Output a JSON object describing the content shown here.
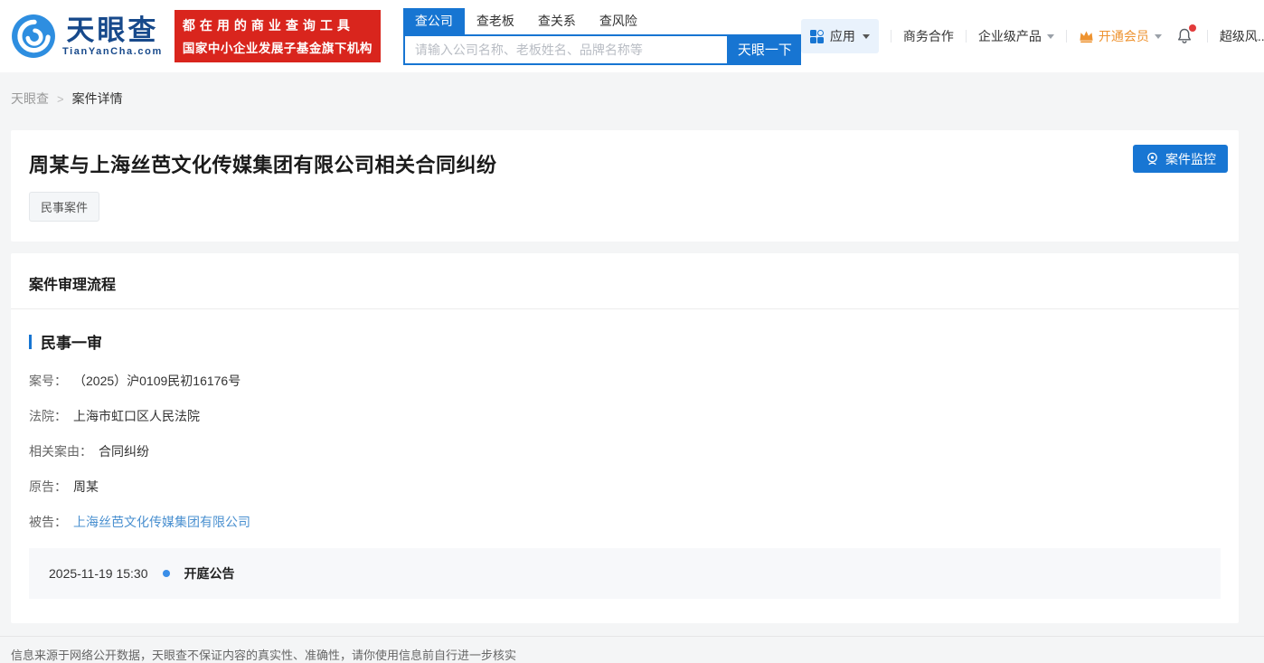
{
  "header": {
    "logo": {
      "title": "天眼查",
      "domain": "TianYanCha.com"
    },
    "promo": {
      "line1": "都在用的商业查询工具",
      "line2": "国家中小企业发展子基金旗下机构"
    },
    "search": {
      "tabs": [
        {
          "label": "查公司",
          "active": true
        },
        {
          "label": "查老板",
          "active": false
        },
        {
          "label": "查关系",
          "active": false
        },
        {
          "label": "查风险",
          "active": false
        }
      ],
      "placeholder": "请输入公司名称、老板姓名、品牌名称等",
      "button": "天眼一下"
    },
    "nav": {
      "apps": "应用",
      "business": "商务合作",
      "enterprise": "企业级产品",
      "vip": "开通会员",
      "super_risk": "超级风..."
    }
  },
  "breadcrumb": {
    "home": "天眼查",
    "separator": ">",
    "current": "案件详情"
  },
  "case": {
    "title": "周某与上海丝芭文化传媒集团有限公司相关合同纠纷",
    "badge": "民事案件",
    "monitor_button": "案件监控",
    "section_title": "案件审理流程",
    "stage_title": "民事一审",
    "fields": [
      {
        "label": "案号：",
        "value": "（2025）沪0109民初16176号"
      },
      {
        "label": "法院：",
        "value": "上海市虹口区人民法院"
      },
      {
        "label": "相关案由：",
        "value": "合同纠纷"
      },
      {
        "label": "原告：",
        "value": "周某"
      },
      {
        "label": "被告：",
        "value": "上海丝芭文化传媒集团有限公司"
      }
    ]
  },
  "timeline": {
    "date": "2025-11-19 15:30",
    "event": "开庭公告"
  },
  "footer": {
    "disclaimer": "信息来源于网络公开数据，天眼查不保证内容的真实性、准确性，请你使用信息前自行进一步核实"
  },
  "colors": {
    "accent_blue": "#1775d2",
    "brand_navy": "#17498b",
    "brand_red": "#d9251d",
    "vip_orange": "#ee9330",
    "link_blue": "#4a90d0",
    "notification_red": "#e23b3b",
    "timeline_bg": "#f7f8fa"
  }
}
